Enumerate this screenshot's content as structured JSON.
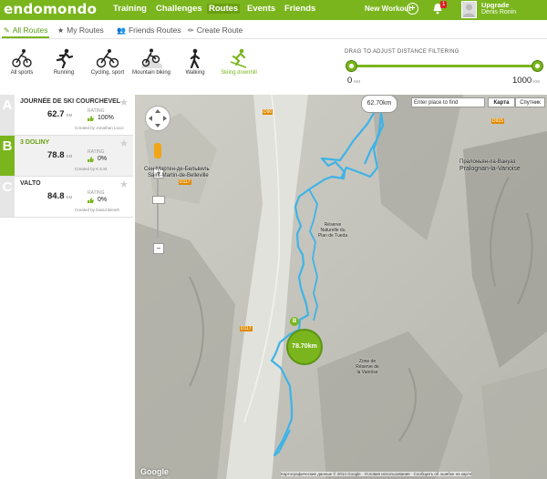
{
  "brand": {
    "logo": "endomondo",
    "color": "#7ab51d"
  },
  "topnav": {
    "items": [
      "Training",
      "Challenges",
      "Routes",
      "Events",
      "Friends"
    ],
    "active": "Routes",
    "new_workout": "New Workout",
    "notifications": "1",
    "upgrade": "Upgrade",
    "user": "Denis Ronin"
  },
  "subnav": {
    "tabs": [
      "All Routes",
      "My Routes",
      "Friends Routes",
      "Create Route"
    ],
    "active": "All Routes"
  },
  "sports": [
    {
      "label": "All sports",
      "icon": "all-sports-icon"
    },
    {
      "label": "Running",
      "icon": "running-icon"
    },
    {
      "label": "Cycling, sport",
      "icon": "cycling-icon"
    },
    {
      "label": "Mountain biking",
      "icon": "mountain-biking-icon"
    },
    {
      "label": "Walking",
      "icon": "walking-icon"
    },
    {
      "label": "Skiing downhill",
      "icon": "skiing-icon"
    }
  ],
  "distance_filter": {
    "title": "DRAG TO ADJUST DISTANCE FILTERING",
    "min": "0",
    "max": "1000",
    "unit": "KM"
  },
  "routes": [
    {
      "letter": "A",
      "name": "JOURNÉE DE SKI COURCHEVEL",
      "distance": "62.7",
      "unit": "KM",
      "rating_label": "RATING",
      "rating": "100%",
      "created": "Created by Jonathan Locci"
    },
    {
      "letter": "B",
      "name": "3 DOLINY",
      "distance": "78.8",
      "unit": "KM",
      "rating_label": "RATING",
      "rating": "0%",
      "created": "Created by К S.M"
    },
    {
      "letter": "C",
      "name": "VALTO",
      "distance": "84.8",
      "unit": "KM",
      "rating_label": "RATING",
      "rating": "0%",
      "created": "Created by David Beneh"
    }
  ],
  "map": {
    "search_placeholder": "Enter place to find",
    "map_types": [
      "Карта",
      "Спутник"
    ],
    "labels": {
      "town1": "Сен-Мартен-де-Бельвиль",
      "town2": "Saint-Martin-de-Belleville",
      "town3": "Пралоньян-ла-Вануаз",
      "town4": "Pralognan-la-Vanoise",
      "reserve": "Réserve Naturelle du Plan de Tueda",
      "zone": "Zone de Réserve de la Vanoise"
    },
    "roads": [
      "D90",
      "D117",
      "D117",
      "D915"
    ],
    "markers": {
      "a_km": "62.70km",
      "b_km": "78.70km"
    },
    "google": "Google",
    "footer": "Картографические данные © 2014 Google · Условия использования · Сообщить об ошибке на карте"
  }
}
